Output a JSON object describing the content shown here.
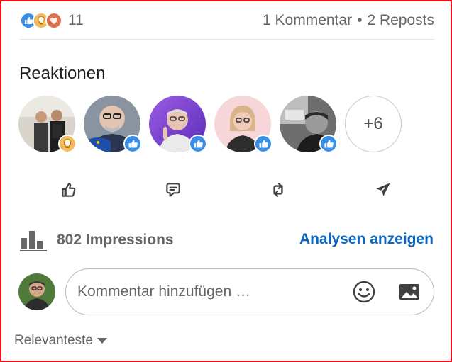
{
  "social_counts": {
    "reaction_icons": [
      "like-icon",
      "insightful-icon",
      "love-icon"
    ],
    "reaction_count": "11",
    "comments": "1 Kommentar",
    "separator": "•",
    "reposts": "2 Reposts"
  },
  "reactions_section": {
    "title": "Reaktionen",
    "reactors": [
      {
        "badge": "insightful-icon"
      },
      {
        "badge": "like-icon"
      },
      {
        "badge": "like-icon"
      },
      {
        "badge": "like-icon"
      },
      {
        "badge": "like-icon"
      }
    ],
    "more_count": "+6"
  },
  "actions": [
    {
      "icon": "like-icon"
    },
    {
      "icon": "comment-icon"
    },
    {
      "icon": "repost-icon"
    },
    {
      "icon": "send-icon"
    }
  ],
  "impressions": {
    "icon": "bar-chart-icon",
    "text": "802 Impressions",
    "analytics_link": "Analysen anzeigen"
  },
  "comment_box": {
    "placeholder": "Kommentar hinzufügen …",
    "icons": [
      "emoji-icon",
      "image-icon"
    ]
  },
  "sort": {
    "label": "Relevanteste"
  },
  "colors": {
    "link": "#0a66c2",
    "like_blue": "#378fe9",
    "insight_yellow": "#f5bb5c",
    "love_red": "#df704d",
    "frame_red": "#e8101a"
  }
}
